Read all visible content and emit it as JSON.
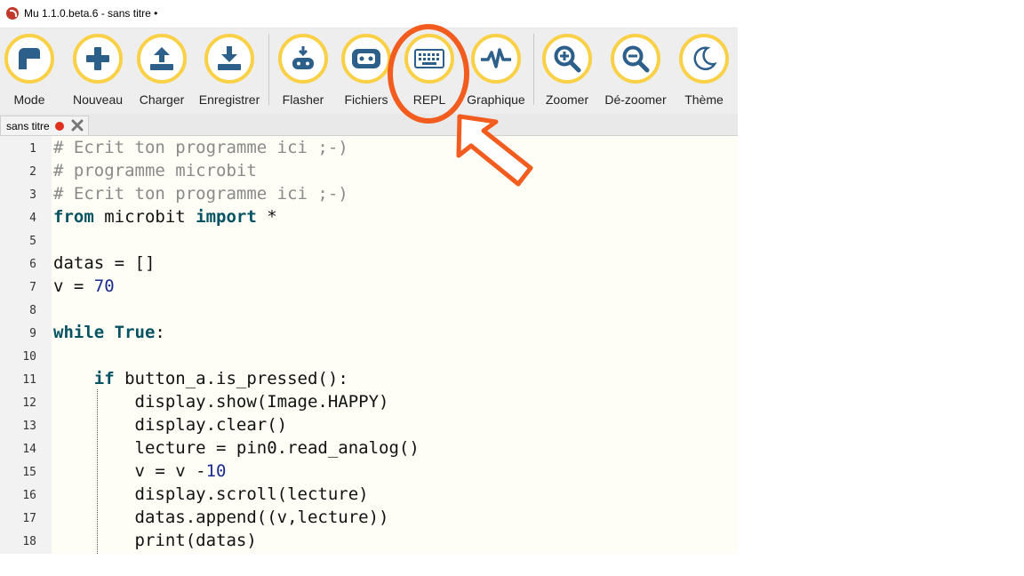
{
  "window": {
    "title": "Mu 1.1.0.beta.6 - sans titre •"
  },
  "toolbar": {
    "buttons": [
      {
        "label": "Mode",
        "icon": "mode-icon"
      },
      {
        "label": "Nouveau",
        "icon": "plus-icon"
      },
      {
        "label": "Charger",
        "icon": "upload-icon"
      },
      {
        "label": "Enregistrer",
        "icon": "download-icon"
      },
      {
        "label": "Flasher",
        "icon": "flash-icon"
      },
      {
        "label": "Fichiers",
        "icon": "files-icon"
      },
      {
        "label": "REPL",
        "icon": "keyboard-icon"
      },
      {
        "label": "Graphique",
        "icon": "pulse-icon"
      },
      {
        "label": "Zoomer",
        "icon": "zoom-in-icon"
      },
      {
        "label": "Dé-zoomer",
        "icon": "zoom-out-icon"
      },
      {
        "label": "Thème",
        "icon": "moon-icon"
      }
    ]
  },
  "tab": {
    "label": "sans titre",
    "modified_color": "#e0301e"
  },
  "editor": {
    "line_numbers": [
      "1",
      "2",
      "3",
      "4",
      "5",
      "6",
      "7",
      "8",
      "9",
      "10",
      "11",
      "12",
      "13",
      "14",
      "15",
      "16",
      "17",
      "18"
    ],
    "lines": [
      "# Ecrit ton programme ici ;-)",
      "# programme microbit",
      "# Ecrit ton programme ici ;-)",
      "from microbit import *",
      "",
      "datas = []",
      "v = 70",
      "",
      "while True:",
      "",
      "    if button_a.is_pressed():",
      "        display.show(Image.HAPPY)",
      "        display.clear()",
      "        lecture = pin0.read_analog()",
      "        v = v -10",
      "        display.scroll(lecture)",
      "        datas.append((v,lecture))",
      "        print(datas)"
    ]
  },
  "colors": {
    "toolbar_ring": "#f9d046",
    "icon": "#2d5f8b",
    "annotation": "#f25c1f"
  }
}
